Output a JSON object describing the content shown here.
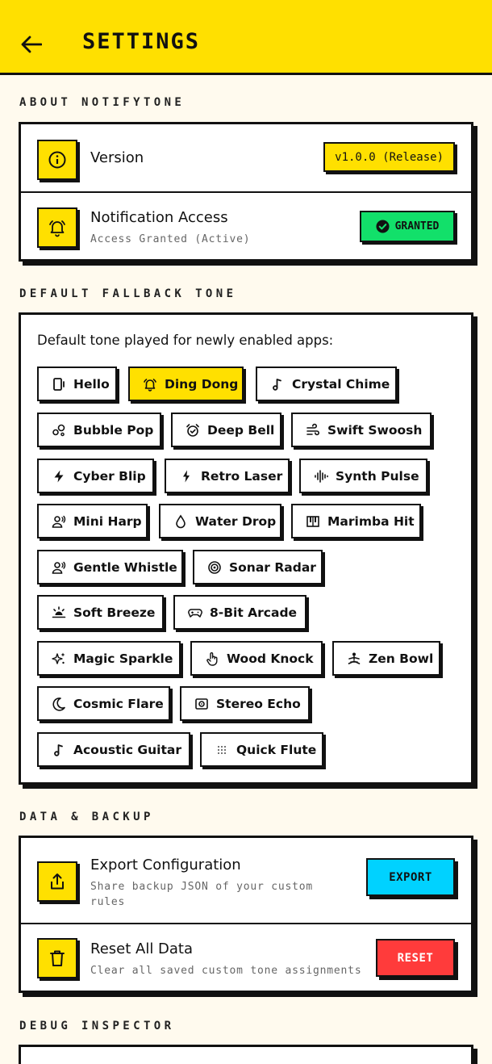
{
  "header": {
    "title": "SETTINGS"
  },
  "about": {
    "label": "ABOUT NOTIFYTONE",
    "version": {
      "title": "Version",
      "value": "v1.0.0 (Release)"
    },
    "access": {
      "title": "Notification Access",
      "subtitle": "Access Granted (Active)",
      "badge": "GRANTED"
    }
  },
  "fallback": {
    "label": "DEFAULT FALLBACK TONE",
    "intro": "Default tone played for newly enabled apps:",
    "selected": "Ding Dong",
    "tones": [
      "Hello",
      "Ding Dong",
      "Crystal Chime",
      "Bubble Pop",
      "Deep Bell",
      "Swift Swoosh",
      "Cyber Blip",
      "Retro Laser",
      "Synth Pulse",
      "Mini Harp",
      "Water Drop",
      "Marimba Hit",
      "Gentle Whistle",
      "Sonar Radar",
      "Soft Breeze",
      "8-Bit Arcade",
      "Magic Sparkle",
      "Wood Knock",
      "Zen Bowl",
      "Cosmic Flare",
      "Stereo Echo",
      "Acoustic Guitar",
      "Quick Flute"
    ]
  },
  "backup": {
    "label": "DATA & BACKUP",
    "export": {
      "title": "Export Configuration",
      "subtitle": "Share backup JSON of your custom rules",
      "button": "EXPORT"
    },
    "reset": {
      "title": "Reset All Data",
      "subtitle": "Clear all saved custom tone assignments",
      "button": "RESET"
    }
  },
  "debug": {
    "label": "DEBUG INSPECTOR"
  },
  "colors": {
    "accent": "#ffe000",
    "success": "#12e06a",
    "export": "#00d2ff",
    "danger": "#ff3b3b",
    "background": "#fffaee"
  }
}
